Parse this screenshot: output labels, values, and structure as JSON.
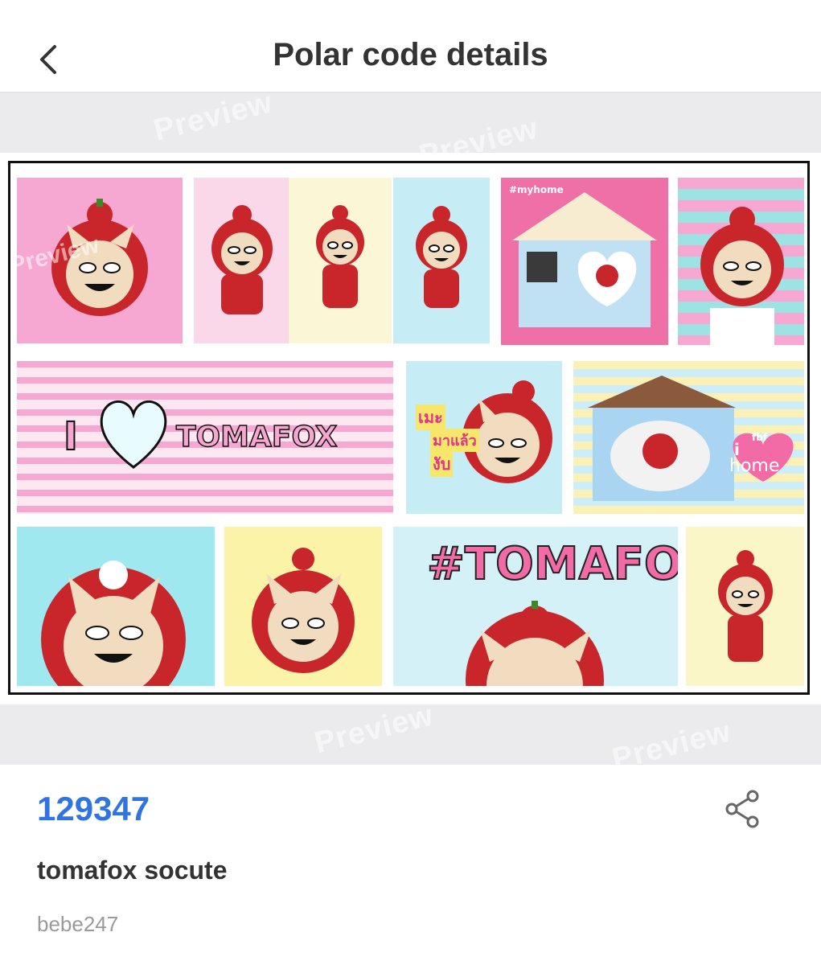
{
  "header": {
    "title": "Polar code details",
    "back_icon": "chevron-left-icon"
  },
  "preview": {
    "watermark": "Preview",
    "collage_texts": {
      "i_love": "I",
      "tomafox": "TOMAFOX",
      "hashtag": "#TOMAFOX",
      "thai_line1": "เมะ",
      "thai_line2": "มาแล้ว",
      "thai_line3": "งับ",
      "i_home": "i",
      "home": "home",
      "fbf": "fbf",
      "myhome": "#myhome"
    }
  },
  "details": {
    "code": "129347",
    "description": "tomafox socute",
    "author": "bebe247",
    "share_icon": "share-icon"
  },
  "colors": {
    "code_blue": "#2f74e0",
    "pink": "#f39ac8",
    "cyan": "#bfeaf3",
    "yellow": "#fbf6c8"
  }
}
